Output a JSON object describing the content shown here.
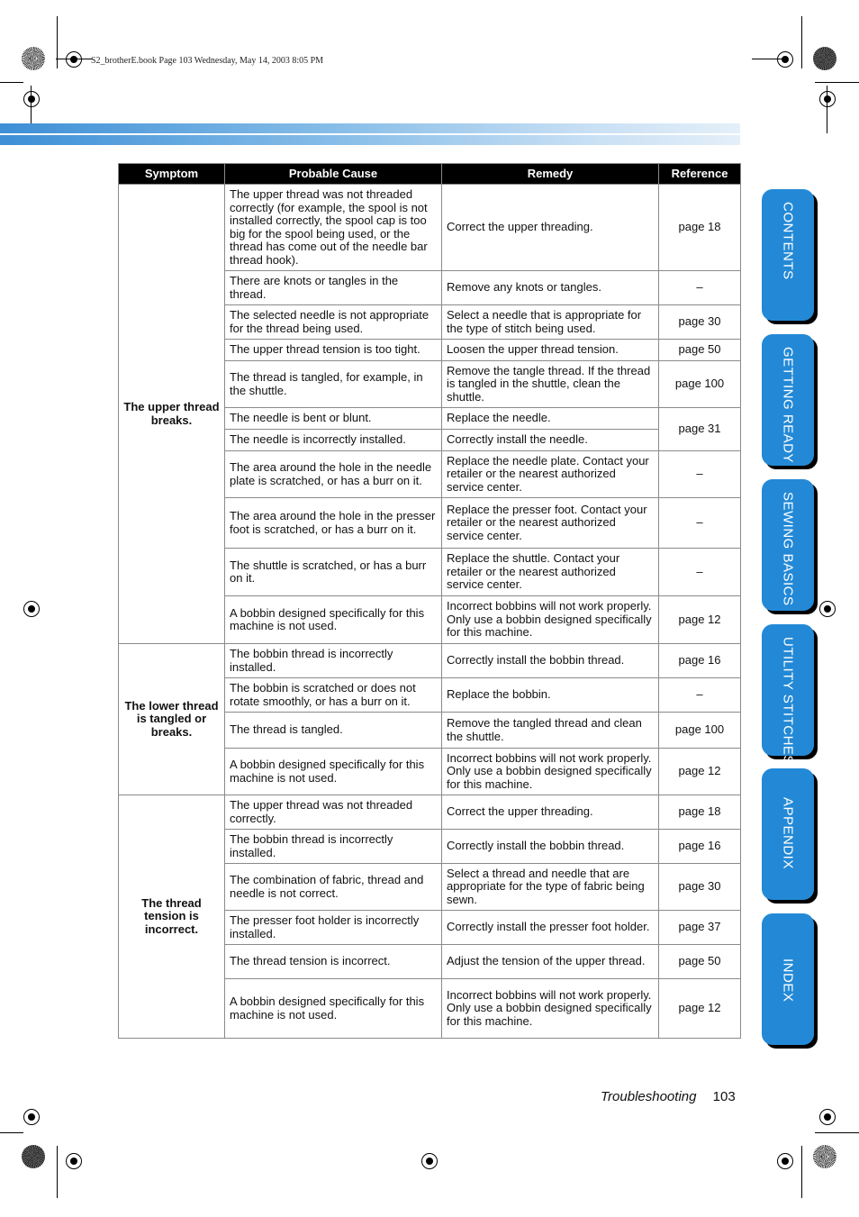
{
  "print_header": "S2_brotherE.book  Page 103  Wednesday, May 14, 2003  8:05 PM",
  "table": {
    "headers": [
      "Symptom",
      "Probable Cause",
      "Remedy",
      "Reference"
    ],
    "groups": [
      {
        "symptom": "The upper thread breaks.",
        "rows": [
          {
            "cause": "The upper thread was not threaded correctly (for example, the spool is not installed correctly, the spool cap is too big for the spool being used, or the thread has come out of the needle bar thread hook).",
            "remedy": "Correct the upper threading.",
            "reference": "page 18"
          },
          {
            "cause": "There are knots or tangles in the thread.",
            "remedy": "Remove any knots or tangles.",
            "reference": "–"
          },
          {
            "cause": "The selected needle is not appropriate for the thread being used.",
            "remedy": "Select a needle that is appropriate for the type of stitch being used.",
            "reference": "page 30"
          },
          {
            "cause": "The upper thread tension is too tight.",
            "remedy": "Loosen the upper thread tension.",
            "reference": "page 50"
          },
          {
            "cause": "The thread is tangled, for example, in the shuttle.",
            "remedy": "Remove the tangle thread. If the thread is tangled in the shuttle, clean the shuttle.",
            "reference": "page 100"
          },
          {
            "cause": "The needle is bent or blunt.",
            "remedy": "Replace the needle.",
            "reference": "page 31"
          },
          {
            "cause": "The needle is incorrectly installed.",
            "remedy": "Correctly install the needle.",
            "reference": ""
          },
          {
            "cause": "The area around the hole in the needle plate is scratched, or has a burr on it.",
            "remedy": "Replace the needle plate. Contact your retailer or the nearest authorized service center.",
            "reference": "–"
          },
          {
            "cause": "The area around the hole in the presser foot is scratched, or has a burr on it.",
            "remedy": "Replace the presser foot. Contact your retailer or the nearest authorized service center.",
            "reference": "–"
          },
          {
            "cause": "The shuttle is scratched, or has a burr on it.",
            "remedy": "Replace the shuttle. Contact your retailer or the nearest authorized service center.",
            "reference": "–"
          },
          {
            "cause": "A bobbin designed specifically for this machine is not used.",
            "remedy": "Incorrect bobbins will not work properly. Only use a bobbin designed specifically for this machine.",
            "reference": "page 12"
          }
        ]
      },
      {
        "symptom": "The lower thread is tangled or breaks.",
        "rows": [
          {
            "cause": "The bobbin thread is incorrectly installed.",
            "remedy": "Correctly install the bobbin thread.",
            "reference": "page 16"
          },
          {
            "cause": "The bobbin is scratched or does not rotate smoothly, or has a burr on it.",
            "remedy": "Replace the bobbin.",
            "reference": "–"
          },
          {
            "cause": "The thread is tangled.",
            "remedy": "Remove the tangled thread and clean the shuttle.",
            "reference": "page 100"
          },
          {
            "cause": "A bobbin designed specifically for this machine is not used.",
            "remedy": "Incorrect bobbins will not work properly. Only use a bobbin designed specifically for this machine.",
            "reference": "page 12"
          }
        ]
      },
      {
        "symptom": "The thread tension is incorrect.",
        "rows": [
          {
            "cause": "The upper thread was not threaded correctly.",
            "remedy": "Correct the upper threading.",
            "reference": "page 18"
          },
          {
            "cause": "The bobbin thread is incorrectly installed.",
            "remedy": "Correctly install the bobbin thread.",
            "reference": "page 16"
          },
          {
            "cause": "The combination of fabric, thread and needle is not correct.",
            "remedy": "Select a thread and needle that are appropriate for the type of fabric being sewn.",
            "reference": "page 30"
          },
          {
            "cause": "The presser foot holder is incorrectly installed.",
            "remedy": "Correctly install the presser foot holder.",
            "reference": "page 37"
          },
          {
            "cause": "The thread tension is incorrect.",
            "remedy": "Adjust the tension of the upper thread.",
            "reference": "page 50"
          },
          {
            "cause": "A bobbin designed specifically for this machine is not used.",
            "remedy": "Incorrect bobbins will not work properly. Only use a bobbin designed specifically for this machine.",
            "reference": "page 12"
          }
        ]
      }
    ]
  },
  "side_tabs": [
    {
      "label": "CONTENTS"
    },
    {
      "label": "GETTING READY"
    },
    {
      "label": "SEWING BASICS"
    },
    {
      "label": "UTILITY STITCHES"
    },
    {
      "label": "APPENDIX"
    },
    {
      "label": "INDEX"
    }
  ],
  "footer": {
    "section": "Troubleshooting",
    "page": "103"
  },
  "colors": {
    "tab_blue": "#2389d6",
    "header_black": "#000000"
  }
}
